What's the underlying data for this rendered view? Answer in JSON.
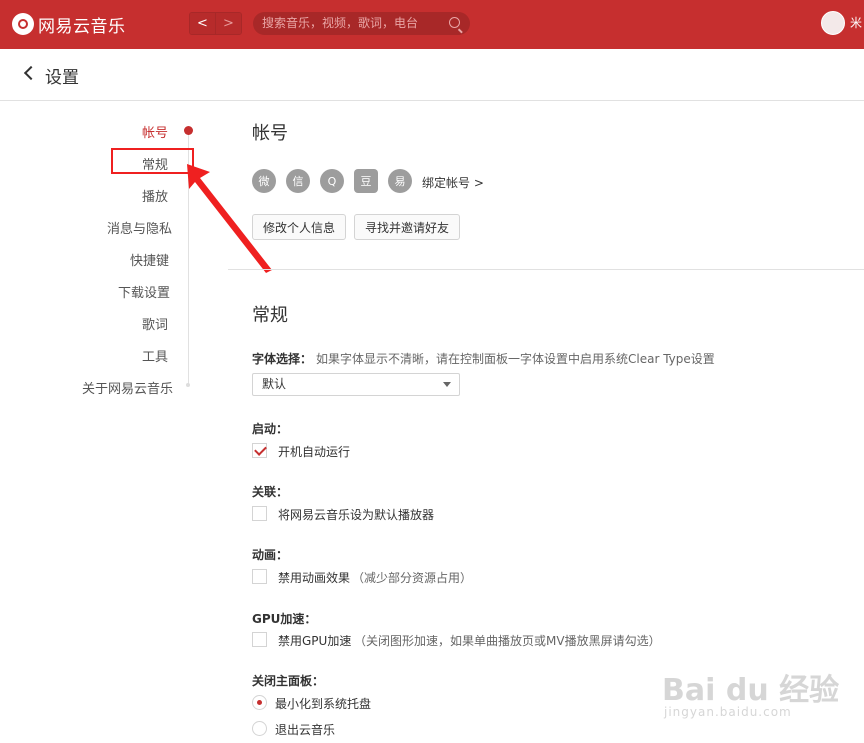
{
  "app": {
    "name": "网易云音乐",
    "brand_color": "#c62f2f"
  },
  "topbar": {
    "back": "<",
    "forward": ">",
    "search_placeholder": "搜索音乐，视频，歌词，电台",
    "user_initial": "米"
  },
  "header": {
    "title": "设置"
  },
  "nav": {
    "items": [
      "帐号",
      "常规",
      "播放",
      "消息与隐私",
      "快捷键",
      "下载设置",
      "歌词",
      "工具",
      "关于网易云音乐"
    ],
    "active_index": 0,
    "highlighted_index": 1
  },
  "account": {
    "title": "帐号",
    "social_icons": [
      "weibo-icon",
      "wechat-icon",
      "qq-icon",
      "douban-icon",
      "yixin-icon"
    ],
    "social_glyphs": [
      "微",
      "信",
      "Q",
      "豆",
      "易"
    ],
    "bind_label": "绑定帐号 >",
    "edit_button": "修改个人信息",
    "invite_button": "寻找并邀请好友"
  },
  "general": {
    "title": "常规",
    "font_label": "字体选择：",
    "font_hint": "如果字体显示不清晰，请在控制面板一字体设置中启用系统Clear Type设置",
    "font_value": "默认",
    "startup_label": "启动：",
    "startup_option": "开机自动运行",
    "startup_checked": true,
    "assoc_label": "关联：",
    "assoc_option": "将网易云音乐设为默认播放器",
    "assoc_checked": false,
    "anim_label": "动画：",
    "anim_option": "禁用动画效果",
    "anim_hint": "（减少部分资源占用）",
    "anim_checked": false,
    "gpu_label": "GPU加速：",
    "gpu_option": "禁用GPU加速",
    "gpu_hint": "（关闭图形加速，如果单曲播放页或MV播放黑屏请勾选）",
    "gpu_checked": false,
    "close_label": "关闭主面板：",
    "close_options": [
      "最小化到系统托盘",
      "退出云音乐"
    ],
    "close_selected": 0
  },
  "watermark": {
    "logo": "Bai du 经验",
    "sub": "jingyan.baidu.com"
  }
}
